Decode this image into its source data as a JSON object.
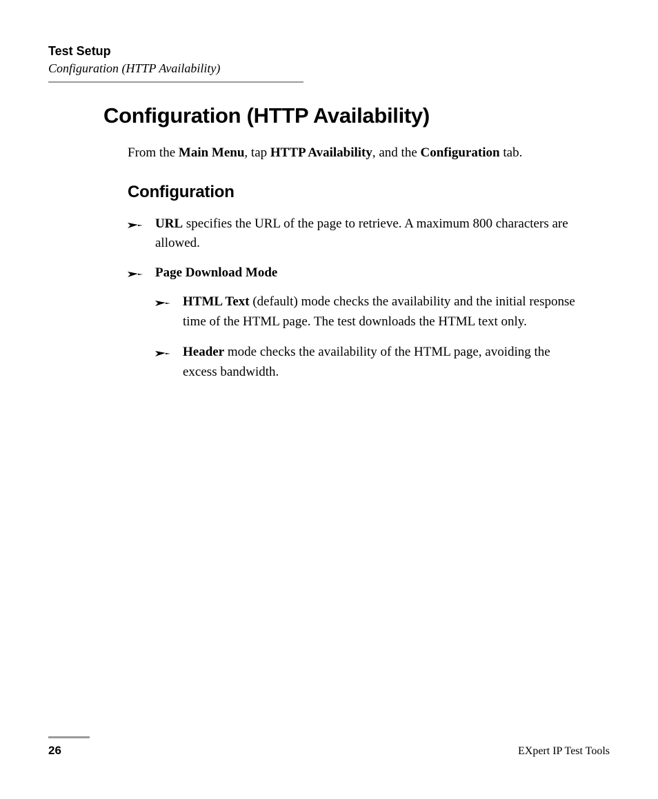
{
  "header": {
    "chapter": "Test Setup",
    "section": "Configuration (HTTP Availability)"
  },
  "main": {
    "heading": "Configuration (HTTP Availability)",
    "intro": {
      "pre": "From the ",
      "b1": "Main Menu",
      "mid1": ", tap ",
      "b2": "HTTP Availability",
      "mid2": ", and the ",
      "b3": "Configuration",
      "post": " tab."
    },
    "subheading": "Configuration",
    "bullets": [
      {
        "b": "URL",
        "text": " specifies the URL of the page to retrieve. A maximum 800 characters are allowed."
      },
      {
        "b": "Page Download Mode",
        "text": ""
      }
    ],
    "nested": [
      {
        "b": "HTML Text",
        "text": " (default) mode checks the availability and the initial response time of the HTML page. The test downloads the HTML text only."
      },
      {
        "b": "Header",
        "text": " mode checks the availability of the HTML page, avoiding the excess bandwidth."
      }
    ]
  },
  "footer": {
    "page": "26",
    "product": "EXpert IP Test Tools"
  }
}
